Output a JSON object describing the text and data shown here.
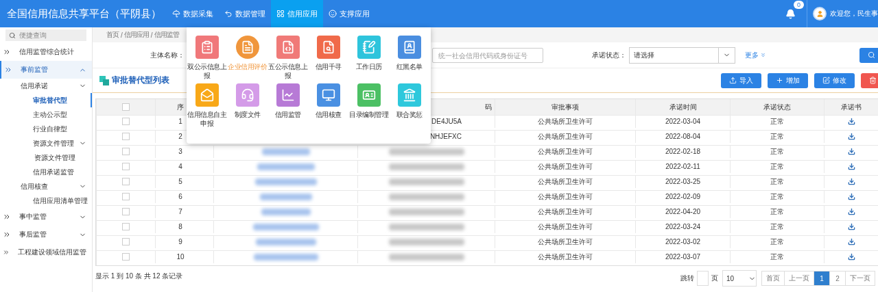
{
  "header": {
    "title": "全国信用信息共享平台（平阴县）",
    "nav": [
      {
        "label": "数据采集",
        "selected": false
      },
      {
        "label": "数据管理",
        "selected": false
      },
      {
        "label": "信用应用",
        "selected": true
      },
      {
        "label": "支撑应用",
        "selected": false
      }
    ],
    "notification_count": "0",
    "user_greeting": "欢迎您，民生事"
  },
  "sidebar": {
    "search_placeholder": "便捷查询",
    "items": [
      {
        "label": "信用监管综合统计",
        "selected": false
      },
      {
        "label": "事前监管",
        "selected": true,
        "expanded": true,
        "children": [
          {
            "label": "信用承诺",
            "selected": false,
            "expanded": true,
            "children": [
              {
                "label": "审批替代型",
                "selected": true
              },
              {
                "label": "主动公示型",
                "selected": false
              },
              {
                "label": "行业自律型",
                "selected": false
              },
              {
                "label": "资源文件管理",
                "selected": false,
                "expanded": true,
                "children": [
                  {
                    "label": "资源文件管理",
                    "selected": false
                  }
                ]
              },
              {
                "label": "信用承诺监管",
                "selected": false
              }
            ]
          },
          {
            "label": "信用核查",
            "selected": false,
            "expanded": true,
            "children": [
              {
                "label": "信用应用清单管理",
                "selected": false
              }
            ]
          }
        ]
      },
      {
        "label": "事中监管",
        "selected": false,
        "expanded": false
      },
      {
        "label": "事后监管",
        "selected": false,
        "expanded": false
      },
      {
        "label": "工程建设领域信用监管",
        "selected": false
      }
    ]
  },
  "breadcrumb": [
    "首页",
    "信用应用",
    "信用监管"
  ],
  "breadcrumb_separator": "/",
  "filters": {
    "name_label": "主体名称：",
    "code_placeholder": "统一社会信用代码或身份证号",
    "status_label": "承诺状态：",
    "status_value": "请选择",
    "more": "更多"
  },
  "list_title": "审批替代型列表",
  "actions": [
    {
      "label": "导入",
      "kind": "import"
    },
    {
      "label": "增加",
      "kind": "add"
    },
    {
      "label": "修改",
      "kind": "edit"
    },
    {
      "kind": "delete"
    }
  ],
  "table": {
    "header_checked": false,
    "columns": [
      "序",
      "",
      "码",
      "审批事项",
      "承诺时间",
      "承诺状态",
      "承诺书"
    ],
    "rows": [
      {
        "index": "1",
        "code": "DE4JU5A",
        "item": "公共场所卫生许可",
        "time": "2022-03-04",
        "status": "正常",
        "checked": false
      },
      {
        "index": "2",
        "code": "NHJEFXC",
        "item": "公共场所卫生许可",
        "time": "2022-08-04",
        "status": "正常",
        "checked": false
      },
      {
        "index": "3",
        "item": "公共场所卫生许可",
        "time": "2022-02-18",
        "status": "正常",
        "checked": false
      },
      {
        "index": "4",
        "item": "公共场所卫生许可",
        "time": "2022-02-11",
        "status": "正常",
        "checked": false
      },
      {
        "index": "5",
        "item": "公共场所卫生许可",
        "time": "2022-03-25",
        "status": "正常",
        "checked": false
      },
      {
        "index": "6",
        "item": "公共场所卫生许可",
        "time": "2022-02-09",
        "status": "正常",
        "checked": false
      },
      {
        "index": "7",
        "item": "公共场所卫生许可",
        "time": "2022-04-20",
        "status": "正常",
        "checked": false
      },
      {
        "index": "8",
        "item": "公共场所卫生许可",
        "time": "2022-03-24",
        "status": "正常",
        "checked": false
      },
      {
        "index": "9",
        "item": "公共场所卫生许可",
        "time": "2022-03-02",
        "status": "正常",
        "checked": false
      },
      {
        "index": "10",
        "item": "公共场所卫生许可",
        "time": "2022-03-07",
        "status": "正常",
        "checked": false
      }
    ]
  },
  "footer": {
    "summary": "显示 1 到 10 条 共 12 条记录",
    "jump_label": "跳转",
    "page_unit": "页",
    "page_size": "10",
    "pages": [
      {
        "label": "首页",
        "selected": false
      },
      {
        "label": "上一页",
        "selected": false
      },
      {
        "label": "1",
        "selected": true
      },
      {
        "label": "2",
        "selected": false
      },
      {
        "label": "下一页",
        "selected": false
      }
    ]
  },
  "app_menu": [
    {
      "label": "双公示信息上报",
      "color": "#f0787a",
      "selected": false
    },
    {
      "label": "企业信用评价",
      "color": "#f0963c",
      "selected": true
    },
    {
      "label": "五公示信息上报",
      "color": "#f07a78",
      "selected": false
    },
    {
      "label": "信用千寻",
      "color": "#f06a4a",
      "selected": false
    },
    {
      "label": "工作日历",
      "color": "#2ec4dc",
      "selected": false
    },
    {
      "label": "红黑名单",
      "color": "#4a8ee0",
      "selected": false
    },
    {
      "label": "信用信息自主申报",
      "color": "#f8a818",
      "selected": false
    },
    {
      "label": "制度文件",
      "color": "#d49be8",
      "selected": false
    },
    {
      "label": "信用监管",
      "color": "#b77ad6",
      "selected": false
    },
    {
      "label": "信用核查",
      "color": "#4a90e2",
      "selected": false
    },
    {
      "label": "目录编制管理",
      "color": "#4cc064",
      "selected": false
    },
    {
      "label": "联合奖惩",
      "color": "#2ec8dc",
      "selected": false
    }
  ]
}
